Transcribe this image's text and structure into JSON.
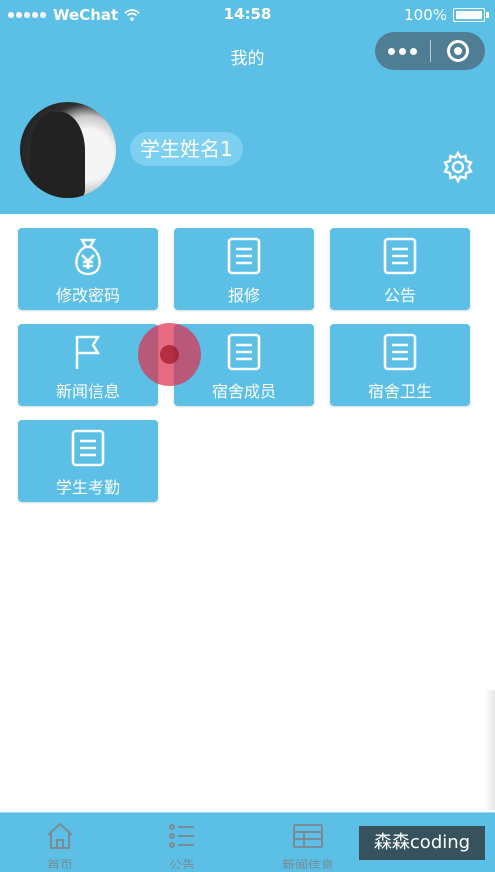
{
  "status_bar": {
    "carrier": "WeChat",
    "time": "14:58",
    "battery": "100%"
  },
  "nav": {
    "title": "我的"
  },
  "profile": {
    "name": "学生姓名1"
  },
  "menu": {
    "tiles": [
      {
        "label": "修改密码",
        "icon": "money-bag-icon"
      },
      {
        "label": "报修",
        "icon": "document-icon"
      },
      {
        "label": "公告",
        "icon": "document-icon"
      },
      {
        "label": "新闻信息",
        "icon": "flag-icon"
      },
      {
        "label": "宿舍成员",
        "icon": "document-icon"
      },
      {
        "label": "宿舍卫生",
        "icon": "document-icon"
      },
      {
        "label": "学生考勤",
        "icon": "document-icon"
      }
    ]
  },
  "tabbar": {
    "items": [
      {
        "label": "首页",
        "icon": "home-icon"
      },
      {
        "label": "公告",
        "icon": "list-icon"
      },
      {
        "label": "新闻信息",
        "icon": "news-icon"
      }
    ]
  },
  "watermark": "森森coding",
  "colors": {
    "primary": "#5bbfe6",
    "capsule": "#4f7d93",
    "touch": "#dc3250"
  }
}
